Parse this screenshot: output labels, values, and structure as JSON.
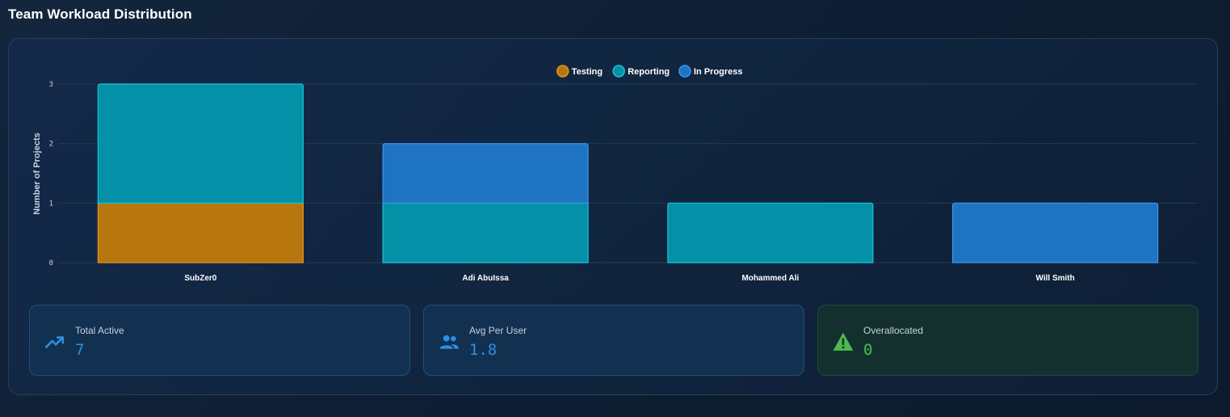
{
  "page": {
    "title": "Team Workload Distribution"
  },
  "chart_data": {
    "type": "bar",
    "stacked": true,
    "categories": [
      "SubZer0",
      "Adi AbuIssa",
      "Mohammed Ali",
      "Will Smith"
    ],
    "series": [
      {
        "name": "Testing",
        "values": [
          1,
          0,
          0,
          0
        ],
        "color": "#b8760f"
      },
      {
        "name": "Reporting",
        "values": [
          2,
          1,
          1,
          0
        ],
        "color": "#0490a6"
      },
      {
        "name": "In Progress",
        "values": [
          0,
          1,
          0,
          1
        ],
        "color": "#1f74c1"
      }
    ],
    "ylabel": "Number of Projects",
    "ylim": [
      0,
      3
    ],
    "yticks": [
      "0",
      "1",
      "2",
      "3"
    ],
    "grid": true,
    "legend": "top-center"
  },
  "colors": {
    "testing_border": "#e0951f",
    "reporting_border": "#17c4dc",
    "in_progress_border": "#3a97f0",
    "accent_blue": "#2b90e6",
    "accent_green": "#4cba4c"
  },
  "stats": [
    {
      "label": "Total Active",
      "value": "7",
      "icon": "trending-up-icon"
    },
    {
      "label": "Avg Per User",
      "value": "1.8",
      "icon": "users-icon"
    },
    {
      "label": "Overallocated",
      "value": "0",
      "icon": "warning-icon"
    }
  ]
}
